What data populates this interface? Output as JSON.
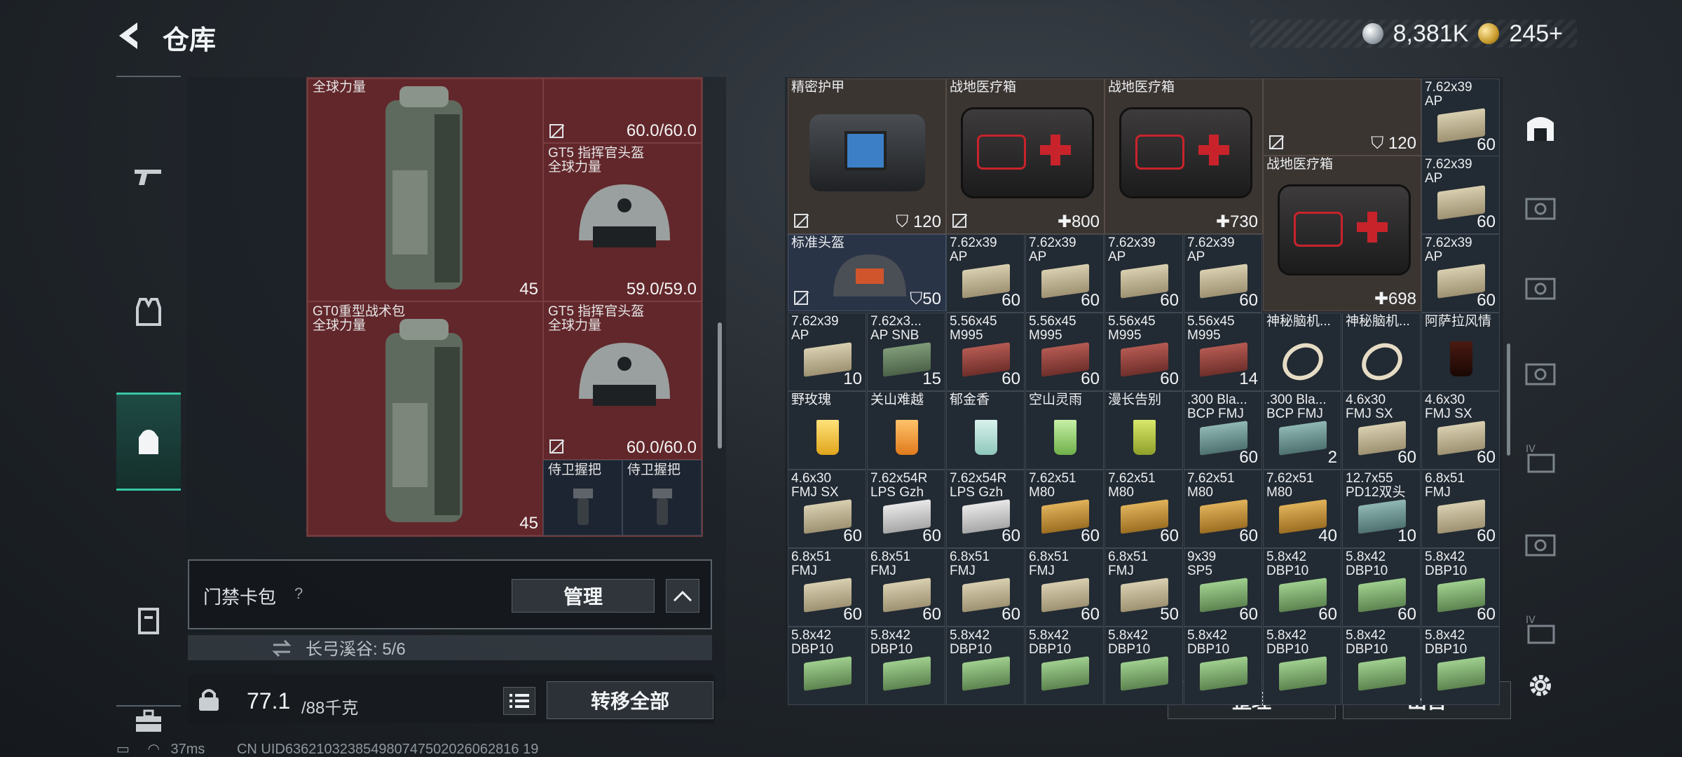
{
  "header": {
    "title": "仓库",
    "currency_silver": "8,381K",
    "currency_gold": "245+"
  },
  "left_sidebar": {
    "icons": [
      "gun-icon",
      "vest-icon",
      "helmet-icon",
      "backpack-icon",
      "pouch-icon",
      "toolbox-icon"
    ],
    "active_index": 3
  },
  "left_grid": {
    "cells": [
      {
        "name": "全球力量",
        "sub": "",
        "value": "45",
        "kind": "backpack"
      },
      {
        "name": "",
        "sub": "",
        "value": "60.0/60.0",
        "kind": "helmet-partial"
      },
      {
        "name": "GT5 指挥官头盔",
        "sub": "全球力量",
        "value": "59.0/59.0",
        "kind": "helmet"
      },
      {
        "name": "GT0重型战术包",
        "sub": "全球力量",
        "value": "45",
        "kind": "backpack"
      },
      {
        "name": "GT5 指挥官头盔",
        "sub": "全球力量",
        "value": "60.0/60.0",
        "kind": "helmet"
      },
      {
        "name": "侍卫握把",
        "sub": "",
        "value": "",
        "kind": "grip"
      },
      {
        "name": "侍卫握把",
        "sub": "",
        "value": "",
        "kind": "grip"
      }
    ]
  },
  "card_pack": {
    "label": "门禁卡包",
    "help": "?",
    "manage": "管理",
    "sub_text": "长弓溪谷: 5/6"
  },
  "capacity": {
    "current": "77.1",
    "max": "/88千克",
    "transfer_all": "转移全部"
  },
  "right_grid": {
    "large": [
      {
        "name": "精密护甲",
        "value": "120",
        "kind": "armor"
      },
      {
        "name": "战地医疗箱",
        "value": "800",
        "kind": "medkit"
      },
      {
        "name": "战地医疗箱",
        "value": "730",
        "kind": "medkit"
      },
      {
        "name": "战地医疗箱",
        "value": "698",
        "kind": "medkit"
      }
    ],
    "top_partial": {
      "value": "120"
    },
    "helmet_small": {
      "name": "标准头盔",
      "value": "50"
    },
    "rows": [
      [
        {
          "name": "7.62x39",
          "sub": "AP",
          "count": "60",
          "color": "tan"
        },
        {
          "name": "7.62x39",
          "sub": "AP",
          "count": "60",
          "color": "tan"
        },
        {
          "name": "7.62x39",
          "sub": "AP",
          "count": "60",
          "color": "tan"
        }
      ],
      [
        {
          "name": "7.62x39",
          "sub": "AP",
          "count": "60",
          "color": "tan"
        },
        {
          "name": "7.62x39",
          "sub": "AP",
          "count": "60",
          "color": "tan"
        },
        {
          "name": "7.62x39",
          "sub": "AP",
          "count": "60",
          "color": "tan"
        },
        {
          "name": "7.62x39",
          "sub": "AP",
          "count": "60",
          "color": "tan"
        },
        {
          "name": "7.62x39",
          "sub": "AP",
          "count": "60",
          "color": "tan"
        }
      ],
      [
        {
          "name": "7.62x39",
          "sub": "AP",
          "count": "10",
          "color": "tan"
        },
        {
          "name": "7.62x3...",
          "sub": "AP SNB",
          "count": "15",
          "color": "dgreen"
        },
        {
          "name": "5.56x45",
          "sub": "M995",
          "count": "60",
          "color": "red"
        },
        {
          "name": "5.56x45",
          "sub": "M995",
          "count": "60",
          "color": "red"
        },
        {
          "name": "5.56x45",
          "sub": "M995",
          "count": "60",
          "color": "red"
        },
        {
          "name": "5.56x45",
          "sub": "M995",
          "count": "14",
          "color": "red"
        },
        {
          "name": "神秘脑机...",
          "sub": "",
          "count": "",
          "color": "watch"
        },
        {
          "name": "神秘脑机...",
          "sub": "",
          "count": "",
          "color": "watch"
        },
        {
          "name": "阿萨拉风情",
          "sub": "",
          "count": "",
          "color": "cola"
        }
      ],
      [
        {
          "name": "野玫瑰",
          "sub": "",
          "count": "",
          "color": "drink-yellow"
        },
        {
          "name": "关山难越",
          "sub": "",
          "count": "",
          "color": "drink-orange"
        },
        {
          "name": "郁金香",
          "sub": "",
          "count": "",
          "color": "drink-clear"
        },
        {
          "name": "空山灵雨",
          "sub": "",
          "count": "",
          "color": "drink-green"
        },
        {
          "name": "漫长告别",
          "sub": "",
          "count": "",
          "color": "drink-martini"
        },
        {
          "name": ".300 Bla...",
          "sub": "BCP FMJ",
          "count": "60",
          "color": "teal"
        },
        {
          "name": ".300 Bla...",
          "sub": "BCP FMJ",
          "count": "2",
          "color": "teal"
        },
        {
          "name": "4.6x30",
          "sub": "FMJ SX",
          "count": "60",
          "color": "tan"
        },
        {
          "name": "4.6x30",
          "sub": "FMJ SX",
          "count": "60",
          "color": "tan"
        }
      ],
      [
        {
          "name": "4.6x30",
          "sub": "FMJ SX",
          "count": "60",
          "color": "tan"
        },
        {
          "name": "7.62x54R",
          "sub": "LPS Gzh",
          "count": "60",
          "color": "white"
        },
        {
          "name": "7.62x54R",
          "sub": "LPS Gzh",
          "count": "60",
          "color": "white"
        },
        {
          "name": "7.62x51",
          "sub": "M80",
          "count": "60",
          "color": "orange"
        },
        {
          "name": "7.62x51",
          "sub": "M80",
          "count": "60",
          "color": "orange"
        },
        {
          "name": "7.62x51",
          "sub": "M80",
          "count": "60",
          "color": "orange"
        },
        {
          "name": "7.62x51",
          "sub": "M80",
          "count": "40",
          "color": "orange"
        },
        {
          "name": "12.7x55",
          "sub": "PD12双头",
          "count": "10",
          "color": "teal"
        },
        {
          "name": "6.8x51",
          "sub": "FMJ",
          "count": "60",
          "color": "tan"
        }
      ],
      [
        {
          "name": "6.8x51",
          "sub": "FMJ",
          "count": "60",
          "color": "tan"
        },
        {
          "name": "6.8x51",
          "sub": "FMJ",
          "count": "60",
          "color": "tan"
        },
        {
          "name": "6.8x51",
          "sub": "FMJ",
          "count": "60",
          "color": "tan"
        },
        {
          "name": "6.8x51",
          "sub": "FMJ",
          "count": "60",
          "color": "tan"
        },
        {
          "name": "6.8x51",
          "sub": "FMJ",
          "count": "50",
          "color": "tan"
        },
        {
          "name": "9x39",
          "sub": "SP5",
          "count": "60",
          "color": "green"
        },
        {
          "name": "5.8x42",
          "sub": "DBP10",
          "count": "60",
          "color": "green"
        },
        {
          "name": "5.8x42",
          "sub": "DBP10",
          "count": "60",
          "color": "green"
        },
        {
          "name": "5.8x42",
          "sub": "DBP10",
          "count": "60",
          "color": "green"
        }
      ],
      [
        {
          "name": "5.8x42",
          "sub": "DBP10",
          "count": "",
          "color": "green"
        },
        {
          "name": "5.8x42",
          "sub": "DBP10",
          "count": "",
          "color": "green"
        },
        {
          "name": "5.8x42",
          "sub": "DBP10",
          "count": "",
          "color": "green"
        },
        {
          "name": "5.8x42",
          "sub": "DBP10",
          "count": "",
          "color": "green"
        },
        {
          "name": "5.8x42",
          "sub": "DBP10",
          "count": "",
          "color": "green"
        },
        {
          "name": "5.8x42",
          "sub": "DBP10",
          "count": "",
          "color": "green"
        },
        {
          "name": "5.8x42",
          "sub": "DBP10",
          "count": "",
          "color": "green"
        },
        {
          "name": "5.8x42",
          "sub": "DBP10",
          "count": "",
          "color": "green"
        },
        {
          "name": "5.8x42",
          "sub": "DBP10",
          "count": "",
          "color": "green"
        }
      ]
    ]
  },
  "bottom_actions": {
    "tidy": "整理",
    "sell": "出售"
  },
  "right_tabs": [
    "bag-icon",
    "case-icon",
    "case-icon",
    "case-icon",
    "case-iv-icon",
    "case-icon",
    "case-iv-icon",
    "settings-gear-icon"
  ],
  "status": {
    "ping": "37ms",
    "uid": "CN UID636210323854980747502026062816 19"
  }
}
